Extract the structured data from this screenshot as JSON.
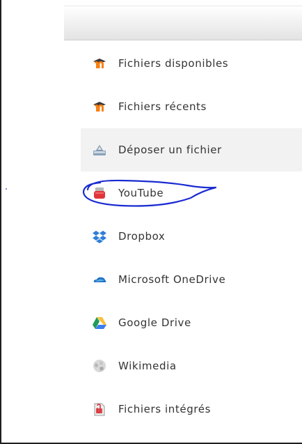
{
  "repositories": [
    {
      "label": "Fichiers disponibles",
      "icon": "moodle-icon"
    },
    {
      "label": "Fichiers récents",
      "icon": "moodle-icon"
    },
    {
      "label": "Déposer un fichier",
      "icon": "upload-icon"
    },
    {
      "label": "YouTube",
      "icon": "youtube-icon"
    },
    {
      "label": "Dropbox",
      "icon": "dropbox-icon"
    },
    {
      "label": "Microsoft OneDrive",
      "icon": "onedrive-icon"
    },
    {
      "label": "Google Drive",
      "icon": "google-drive-icon"
    },
    {
      "label": "Wikimedia",
      "icon": "wikimedia-icon"
    },
    {
      "label": "Fichiers intégrés",
      "icon": "embedded-files-icon"
    }
  ],
  "active_index": 2,
  "colors": {
    "moodle_orange": "#f98012",
    "annotation_blue": "#1a2bd1",
    "active_bg": "#f2f2f2",
    "text": "#333333"
  }
}
